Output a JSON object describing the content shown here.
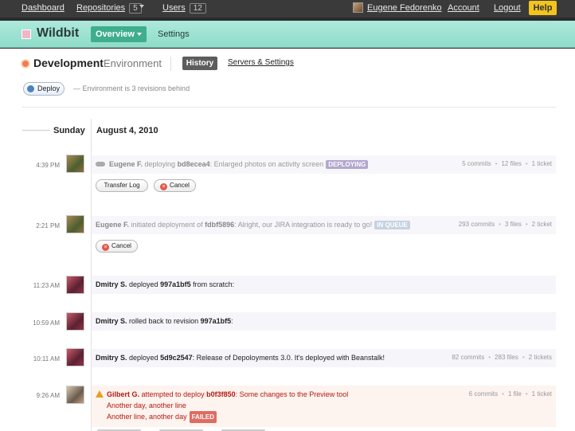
{
  "topbar": {
    "dashboard": "Dashboard",
    "repositories": "Repositories",
    "repositories_count": "5",
    "users": "Users",
    "users_count": "12",
    "user_name": "Eugene Fedorenko",
    "account": "Account",
    "logout": "Logout",
    "help": "Help"
  },
  "project": {
    "name": "Wildbit",
    "overview": "Overview",
    "settings": "Settings"
  },
  "environment": {
    "name": "Development",
    "label": "Environment",
    "tab_history": "History",
    "tab_servers": "Servers & Settings",
    "deploy_button": "Deploy",
    "status": "—   Environment is 3 revisions behind"
  },
  "timeline": {
    "day": "Sunday",
    "date": "August 4, 2010",
    "events": [
      {
        "time": "4:39 PM",
        "user": "Eugene F.",
        "action": "deploying",
        "revision": "bd8ecea4",
        "message": ": Enlarged photos on activity screen",
        "badge": "DEPLOYING",
        "commits": "5 commits",
        "files": "12 files",
        "tickets": "1 ticket",
        "btn_log": "Transfer Log",
        "btn_cancel": "Cancel"
      },
      {
        "time": "2:21 PM",
        "user": "Eugene F.",
        "action": "initiated deployment of",
        "revision": "fdbf5896",
        "message": ": Alright, our JIRA integration is ready to go!",
        "badge": "IN QUEUE",
        "commits": "293 commits",
        "files": "3 files",
        "tickets": "2 ticket",
        "btn_cancel": "Cancel"
      },
      {
        "time": "11:23 AM",
        "user": "Dmitry S.",
        "action": "deployed",
        "revision": "997a1bf5",
        "message": "from scratch:"
      },
      {
        "time": "10:59 AM",
        "user": "Dmitry S.",
        "action": "rolled back to revision",
        "revision": "997a1bf5",
        "message": ":"
      },
      {
        "time": "10:11 AM",
        "user": "Dmitry S.",
        "action": "deployed",
        "revision": "5d9c2547",
        "message": ": Release of Depoloyments 3.0. It's deployed with Beanstalk!",
        "commits": "82 commits",
        "files": "283 files",
        "tickets": "2 tickets"
      },
      {
        "time": "9:26 AM",
        "user": "Gilbert G.",
        "action": "attempted to deploy",
        "revision": "b0f3f850",
        "message": ": Some changes to the Preview tool",
        "line2": "Another day, another line",
        "line3": "Another line, another day",
        "badge": "FAILED",
        "commits": "6 commits",
        "files": "1 file",
        "tickets": "1 ticket"
      }
    ]
  },
  "colors": {
    "topbar": "#3a3a3a",
    "project_bar": "#9fe3d3",
    "overview_button": "#3fae8c",
    "help_button": "#f2c41d",
    "failed_text": "#b31a12"
  }
}
